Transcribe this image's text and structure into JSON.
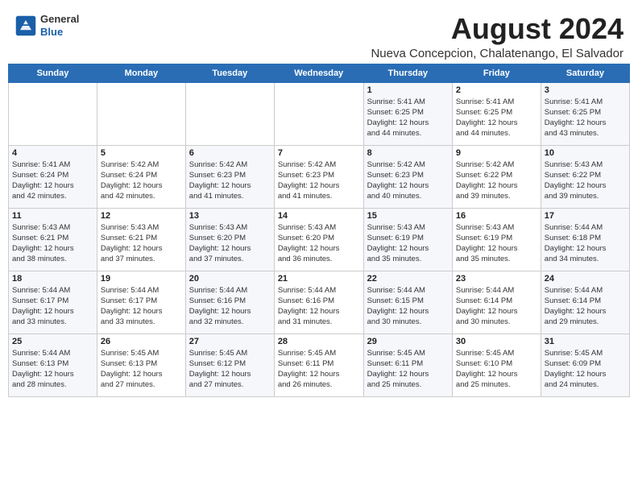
{
  "header": {
    "logo_general": "General",
    "logo_blue": "Blue",
    "month_year": "August 2024",
    "location": "Nueva Concepcion, Chalatenango, El Salvador"
  },
  "calendar": {
    "days_of_week": [
      "Sunday",
      "Monday",
      "Tuesday",
      "Wednesday",
      "Thursday",
      "Friday",
      "Saturday"
    ],
    "weeks": [
      [
        {
          "day": "",
          "info": ""
        },
        {
          "day": "",
          "info": ""
        },
        {
          "day": "",
          "info": ""
        },
        {
          "day": "",
          "info": ""
        },
        {
          "day": "1",
          "info": "Sunrise: 5:41 AM\nSunset: 6:25 PM\nDaylight: 12 hours\nand 44 minutes."
        },
        {
          "day": "2",
          "info": "Sunrise: 5:41 AM\nSunset: 6:25 PM\nDaylight: 12 hours\nand 44 minutes."
        },
        {
          "day": "3",
          "info": "Sunrise: 5:41 AM\nSunset: 6:25 PM\nDaylight: 12 hours\nand 43 minutes."
        }
      ],
      [
        {
          "day": "4",
          "info": "Sunrise: 5:41 AM\nSunset: 6:24 PM\nDaylight: 12 hours\nand 42 minutes."
        },
        {
          "day": "5",
          "info": "Sunrise: 5:42 AM\nSunset: 6:24 PM\nDaylight: 12 hours\nand 42 minutes."
        },
        {
          "day": "6",
          "info": "Sunrise: 5:42 AM\nSunset: 6:23 PM\nDaylight: 12 hours\nand 41 minutes."
        },
        {
          "day": "7",
          "info": "Sunrise: 5:42 AM\nSunset: 6:23 PM\nDaylight: 12 hours\nand 41 minutes."
        },
        {
          "day": "8",
          "info": "Sunrise: 5:42 AM\nSunset: 6:23 PM\nDaylight: 12 hours\nand 40 minutes."
        },
        {
          "day": "9",
          "info": "Sunrise: 5:42 AM\nSunset: 6:22 PM\nDaylight: 12 hours\nand 39 minutes."
        },
        {
          "day": "10",
          "info": "Sunrise: 5:43 AM\nSunset: 6:22 PM\nDaylight: 12 hours\nand 39 minutes."
        }
      ],
      [
        {
          "day": "11",
          "info": "Sunrise: 5:43 AM\nSunset: 6:21 PM\nDaylight: 12 hours\nand 38 minutes."
        },
        {
          "day": "12",
          "info": "Sunrise: 5:43 AM\nSunset: 6:21 PM\nDaylight: 12 hours\nand 37 minutes."
        },
        {
          "day": "13",
          "info": "Sunrise: 5:43 AM\nSunset: 6:20 PM\nDaylight: 12 hours\nand 37 minutes."
        },
        {
          "day": "14",
          "info": "Sunrise: 5:43 AM\nSunset: 6:20 PM\nDaylight: 12 hours\nand 36 minutes."
        },
        {
          "day": "15",
          "info": "Sunrise: 5:43 AM\nSunset: 6:19 PM\nDaylight: 12 hours\nand 35 minutes."
        },
        {
          "day": "16",
          "info": "Sunrise: 5:43 AM\nSunset: 6:19 PM\nDaylight: 12 hours\nand 35 minutes."
        },
        {
          "day": "17",
          "info": "Sunrise: 5:44 AM\nSunset: 6:18 PM\nDaylight: 12 hours\nand 34 minutes."
        }
      ],
      [
        {
          "day": "18",
          "info": "Sunrise: 5:44 AM\nSunset: 6:17 PM\nDaylight: 12 hours\nand 33 minutes."
        },
        {
          "day": "19",
          "info": "Sunrise: 5:44 AM\nSunset: 6:17 PM\nDaylight: 12 hours\nand 33 minutes."
        },
        {
          "day": "20",
          "info": "Sunrise: 5:44 AM\nSunset: 6:16 PM\nDaylight: 12 hours\nand 32 minutes."
        },
        {
          "day": "21",
          "info": "Sunrise: 5:44 AM\nSunset: 6:16 PM\nDaylight: 12 hours\nand 31 minutes."
        },
        {
          "day": "22",
          "info": "Sunrise: 5:44 AM\nSunset: 6:15 PM\nDaylight: 12 hours\nand 30 minutes."
        },
        {
          "day": "23",
          "info": "Sunrise: 5:44 AM\nSunset: 6:14 PM\nDaylight: 12 hours\nand 30 minutes."
        },
        {
          "day": "24",
          "info": "Sunrise: 5:44 AM\nSunset: 6:14 PM\nDaylight: 12 hours\nand 29 minutes."
        }
      ],
      [
        {
          "day": "25",
          "info": "Sunrise: 5:44 AM\nSunset: 6:13 PM\nDaylight: 12 hours\nand 28 minutes."
        },
        {
          "day": "26",
          "info": "Sunrise: 5:45 AM\nSunset: 6:13 PM\nDaylight: 12 hours\nand 27 minutes."
        },
        {
          "day": "27",
          "info": "Sunrise: 5:45 AM\nSunset: 6:12 PM\nDaylight: 12 hours\nand 27 minutes."
        },
        {
          "day": "28",
          "info": "Sunrise: 5:45 AM\nSunset: 6:11 PM\nDaylight: 12 hours\nand 26 minutes."
        },
        {
          "day": "29",
          "info": "Sunrise: 5:45 AM\nSunset: 6:11 PM\nDaylight: 12 hours\nand 25 minutes."
        },
        {
          "day": "30",
          "info": "Sunrise: 5:45 AM\nSunset: 6:10 PM\nDaylight: 12 hours\nand 25 minutes."
        },
        {
          "day": "31",
          "info": "Sunrise: 5:45 AM\nSunset: 6:09 PM\nDaylight: 12 hours\nand 24 minutes."
        }
      ]
    ]
  }
}
